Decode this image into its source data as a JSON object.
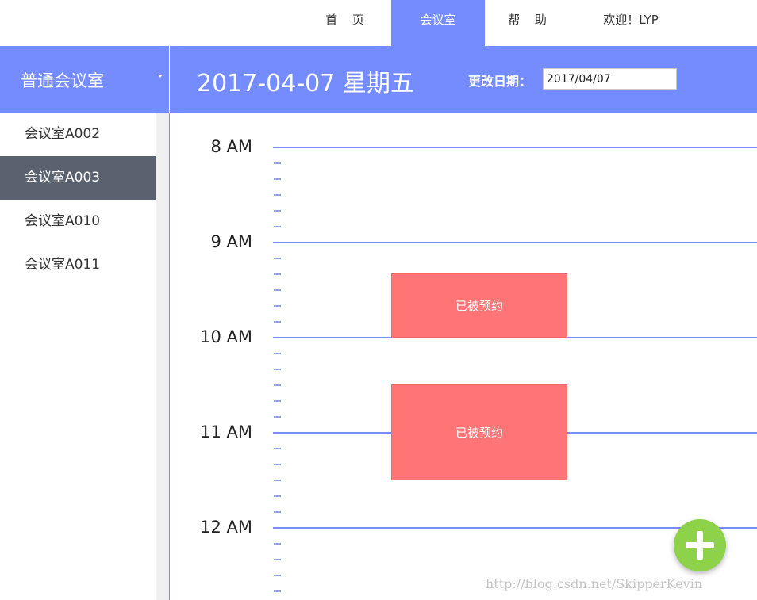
{
  "topnav": {
    "home": "首 页",
    "rooms": "会议室",
    "help": "帮 助",
    "welcome": "欢迎！LYP"
  },
  "header": {
    "room_type": "普通会议室",
    "date_title": "2017-04-07 星期五",
    "change_date_label": "更改日期：",
    "date_input_value": "2017/04/07"
  },
  "sidebar": {
    "items": [
      {
        "label": "会议室A002",
        "active": false
      },
      {
        "label": "会议室A003",
        "active": true
      },
      {
        "label": "会议室A010",
        "active": false
      },
      {
        "label": "会议室A011",
        "active": false
      }
    ]
  },
  "schedule": {
    "hours": [
      "8 AM",
      "9 AM",
      "10 AM",
      "11 AM",
      "12 AM"
    ],
    "ticks_per_hour": 6,
    "bookings": [
      {
        "label": "已被预约",
        "start": "9:20",
        "end": "10:00"
      },
      {
        "label": "已被预约",
        "start": "10:30",
        "end": "11:30"
      }
    ]
  },
  "add_button": {
    "icon": "plus-icon"
  },
  "watermark": "http://blog.csdn.net/SkipperKevin",
  "colors": {
    "accent": "#748cff",
    "sidebar_active": "#5a6270",
    "booking": "#ff7474",
    "add_button": "#8ed24a"
  }
}
